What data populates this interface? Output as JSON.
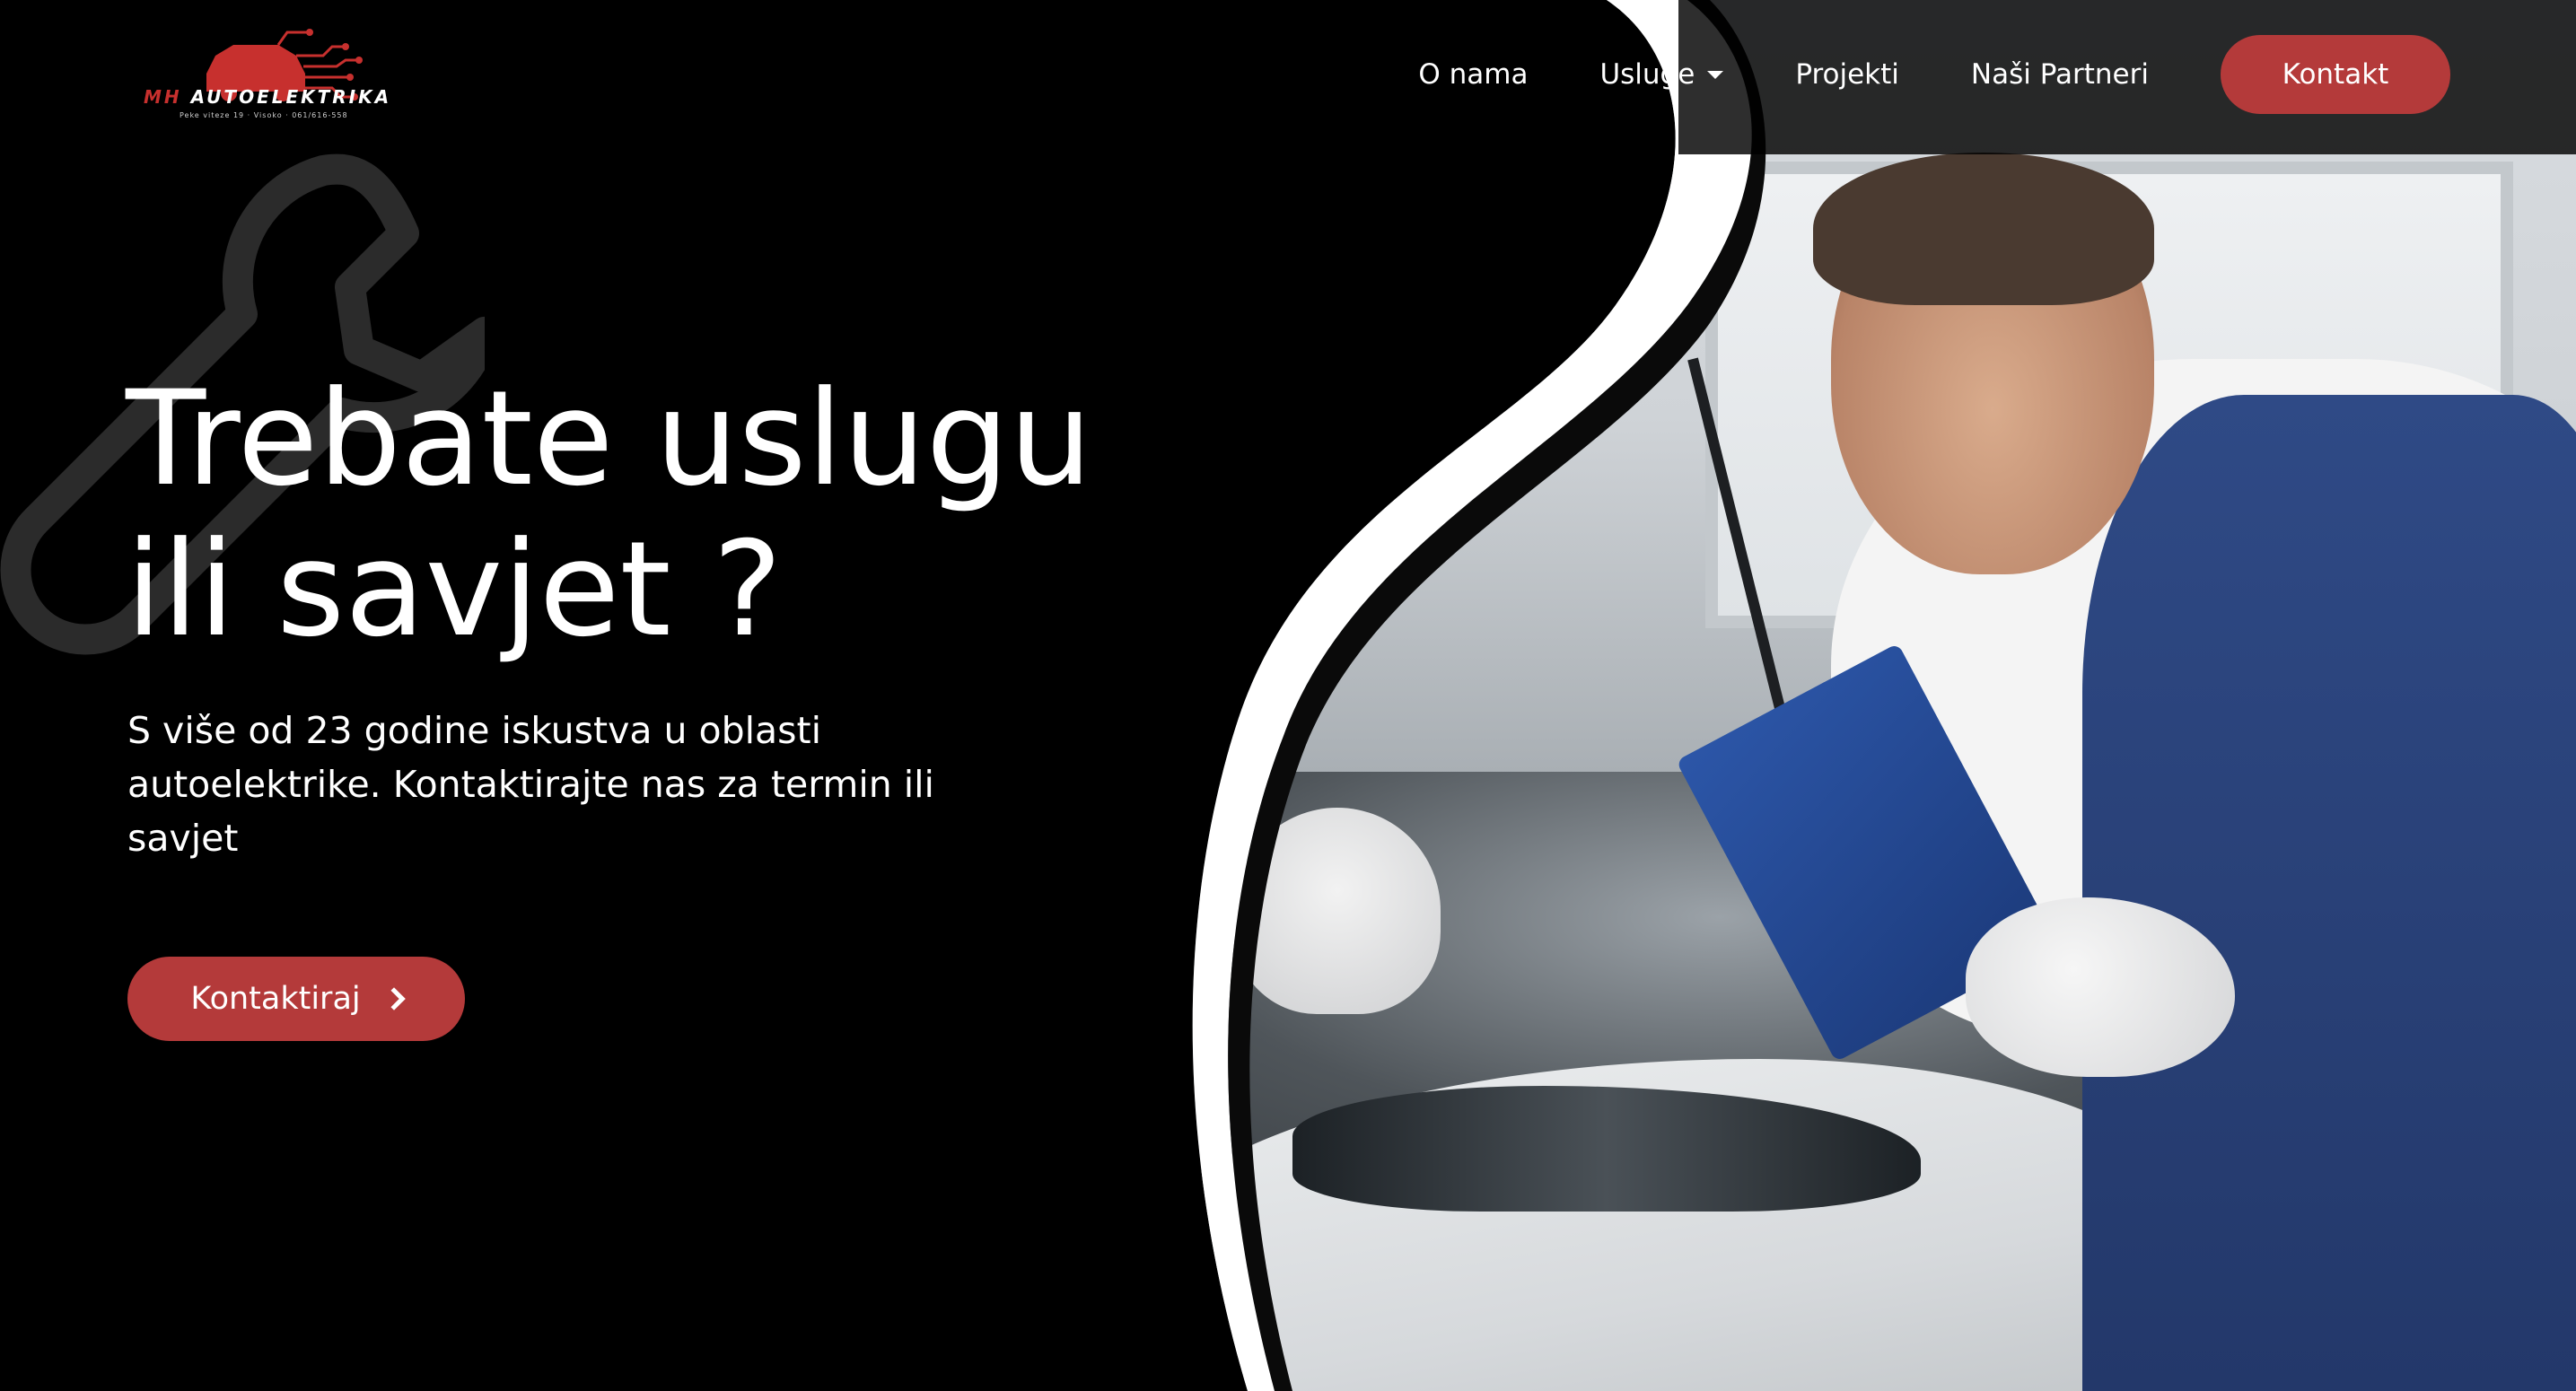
{
  "brand": {
    "name_prefix": "MH",
    "name_suffix": " AUTOELEKTRIKA",
    "tagline": "Peke viteze 19 · Visoko · 061/616-558",
    "accent_color": "#b43a3a"
  },
  "nav": {
    "items": [
      {
        "label": "O nama"
      },
      {
        "label": "Usluge",
        "dropdown": true
      },
      {
        "label": "Projekti"
      },
      {
        "label": "Naši Partneri"
      }
    ],
    "cta_label": "Kontakt"
  },
  "hero": {
    "title": "Trebate uslugu ili savjet ?",
    "subtitle": "S više od 23 godine iskustva u oblasti autoelektrike. Kontaktirajte nas za termin ili savjet",
    "button_label": "Kontaktiraj",
    "button_icon": "chevron-right-icon",
    "decor_icon": "wrench-icon"
  }
}
